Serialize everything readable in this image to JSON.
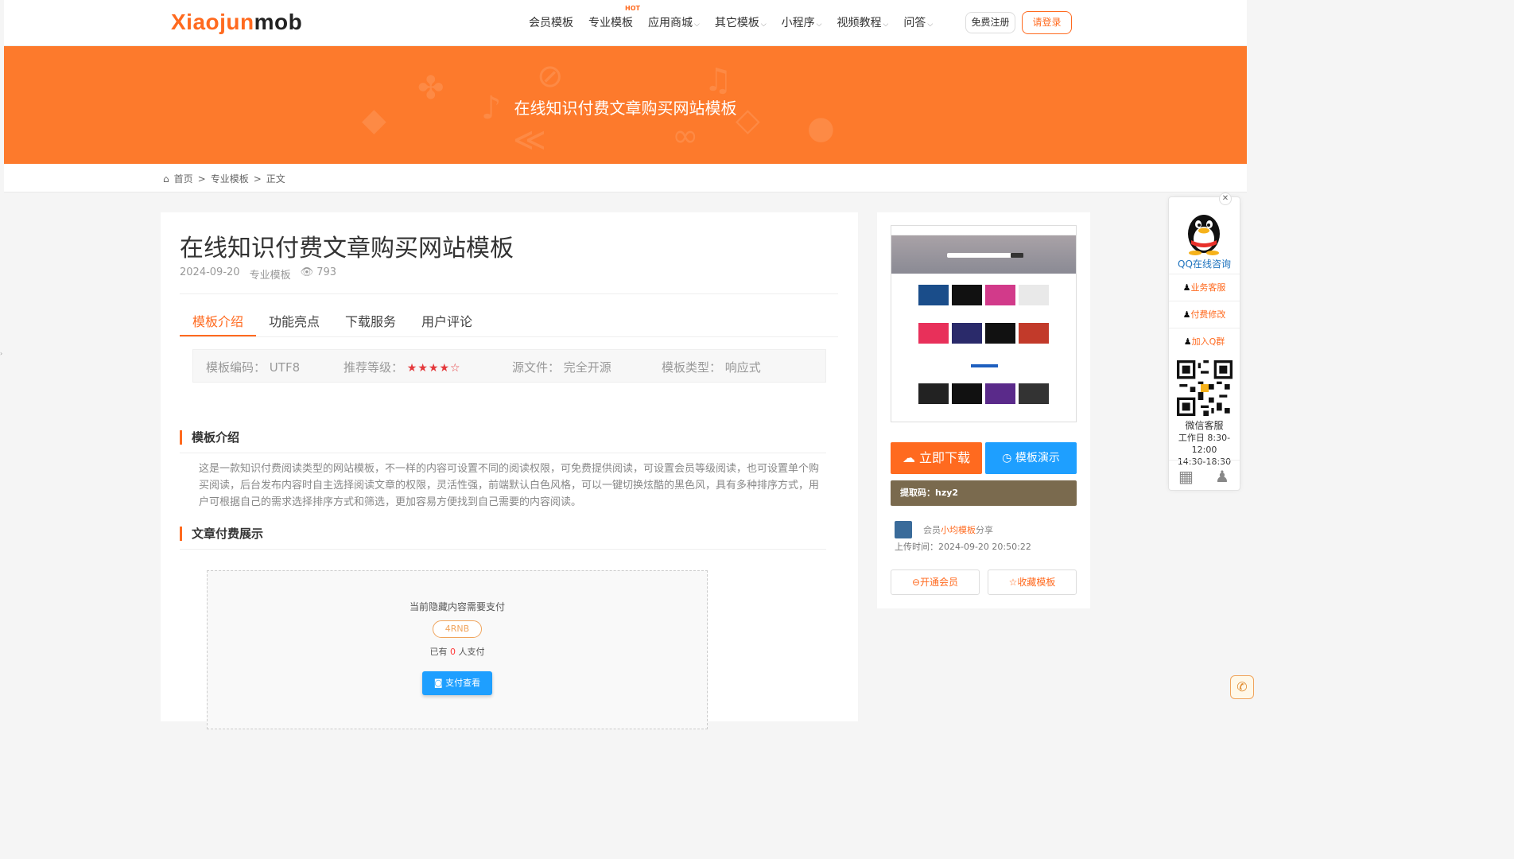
{
  "header": {
    "logo_a": "Xiaojun",
    "logo_b": "mob",
    "nav": [
      {
        "label": "会员模板",
        "caret": false
      },
      {
        "label": "专业模板",
        "caret": false,
        "badge": "HOT"
      },
      {
        "label": "应用商城",
        "caret": true
      },
      {
        "label": "其它模板",
        "caret": true
      },
      {
        "label": "小程序",
        "caret": true
      },
      {
        "label": "视频教程",
        "caret": true
      },
      {
        "label": "问答",
        "caret": true
      }
    ],
    "register": "免费注册",
    "login": "请登录"
  },
  "banner": {
    "title": "在线知识付费文章购买网站模板",
    "color": "#fd7a2c"
  },
  "breadcrumb": {
    "home": "首页",
    "sep1": ">",
    "cat": "专业模板",
    "sep2": ">",
    "current": "正文"
  },
  "post": {
    "title": "在线知识付费文章购买网站模板",
    "date": "2024-09-20",
    "category": "专业模板",
    "views": "793",
    "tabs": [
      "模板介绍",
      "功能亮点",
      "下载服务",
      "用户评论"
    ],
    "info": {
      "code_label": "模板编码：",
      "code_value": "UTF8",
      "level_label": "推荐等级：",
      "level_value": "★★★★☆",
      "source_label": "源文件：",
      "source_value": "完全开源",
      "type_label": "模板类型：",
      "type_value": "响应式"
    },
    "section1_title": "模板介绍",
    "description": "这是一款知识付费阅读类型的网站模板，不一样的内容可设置不同的阅读权限，可免费提供阅读，可设置会员等级阅读，也可设置单个购买阅读，后台发布内容时自主选择阅读文章的权限，灵活性强，前端默认白色风格，可以一键切换炫酷的黑色风，具有多种排序方式，用户可根据自己的需求选择排序方式和筛选，更加容易方便找到自己需要的内容阅读。",
    "section2_title": "文章付费展示",
    "pay": {
      "note": "当前隐藏内容需要支付",
      "price": "4RNB",
      "count_prefix": "已有",
      "count": "0",
      "count_suffix": "人支付",
      "button": "支付查看"
    }
  },
  "sidebar": {
    "download": "立即下载",
    "demo": "模板演示",
    "extract_code": "提取码：hzy2",
    "uploader_prefix": "会员",
    "uploader_name": "小均模板",
    "uploader_suffix": "分享",
    "upload_time": "上传时间：2024-09-20 20:50:22",
    "vip": "开通会员",
    "favorite": "收藏模板"
  },
  "float_panel": {
    "qq": "QQ在线咨询",
    "service": "业务客服",
    "paid_edit": "付费修改",
    "join_group": "加入Q群",
    "wechat": "微信客服",
    "hours1": "工作日 8:30-12:00",
    "hours2": "14:30-18:30"
  }
}
